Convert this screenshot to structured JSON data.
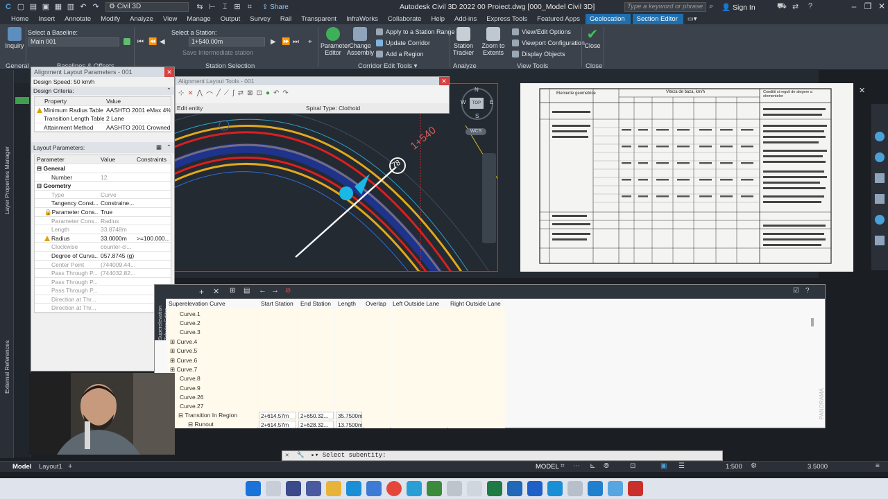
{
  "titlebar": {
    "workspace": "Civil 3D",
    "title": "Autodesk Civil 3D 2022    00 Proiect.dwg [000_Model Civil 3D]",
    "share": "Share",
    "search_placeholder": "Type a keyword or phrase",
    "signin": "Sign In"
  },
  "ribbon_tabs": [
    "Home",
    "Insert",
    "Annotate",
    "Modify",
    "Analyze",
    "View",
    "Manage",
    "Output",
    "Survey",
    "Rail",
    "Transparent",
    "InfraWorks",
    "Collaborate",
    "Help",
    "Add-ins",
    "Express Tools",
    "Featured Apps",
    "Geolocation",
    "Section Editor"
  ],
  "ribbon": {
    "inquiry": "Inquiry",
    "general": "General",
    "baseline_label": "Select a Baseline:",
    "baseline_value": "Main 001",
    "baselines_panel": "Baselines & Offsets",
    "station_label": "Select a Station:",
    "station_value": "1+540.00m",
    "save_intermediate": "Save Intermediate station",
    "station_panel": "Station Selection",
    "parameter_editor": "Parameter Editor",
    "change_assembly": "Change Assembly",
    "apply_range": "Apply to a Station Range",
    "update_corridor": "Update Corridor",
    "add_region": "Add a Region",
    "corridor_panel": "Corridor Edit Tools",
    "station_tracker": "Station Tracker",
    "zoom_extents": "Zoom to Extents",
    "analyze_panel": "Analyze",
    "view_edit_options": "View/Edit Options",
    "viewport_config": "Viewport Configuration",
    "display_objects": "Display Objects",
    "view_tools_panel": "View Tools",
    "close": "Close",
    "close_panel": "Close"
  },
  "alignment_params": {
    "title": "Alignment Layout Parameters - 001",
    "design_speed": "Design Speed: 50 km/h",
    "design_criteria": "Design Criteria:",
    "crit_headers": [
      "Property",
      "Value"
    ],
    "criteria": [
      {
        "prop": "Minimum Radius Table",
        "value": "AASHTO 2001 eMax 4% ..."
      },
      {
        "prop": "Transition Length Table",
        "value": "2 Lane"
      },
      {
        "prop": "Attainment Method",
        "value": "AASHTO 2001 Crowned ..."
      }
    ],
    "layout_params": "Layout Parameters:",
    "lp_headers": [
      "Parameter",
      "Value",
      "Constraints"
    ],
    "groups": [
      "General",
      "Geometry"
    ],
    "rows": [
      {
        "p": "Number",
        "v": "12",
        "c": ""
      },
      {
        "p": "Type",
        "v": "Curve",
        "c": ""
      },
      {
        "p": "Tangency Const...",
        "v": "Constraine...",
        "c": ""
      },
      {
        "p": "Parameter Cons...",
        "v": "True",
        "c": ""
      },
      {
        "p": "Parameter Cons...",
        "v": "Radius",
        "c": ""
      },
      {
        "p": "Length",
        "v": "33.8748m",
        "c": ""
      },
      {
        "p": "Radius",
        "v": "33.0000m",
        "c": ">=100.000..."
      },
      {
        "p": "Clockwise",
        "v": "counter-cl...",
        "c": ""
      },
      {
        "p": "Degree of Curva...",
        "v": "057.8745 (g)",
        "c": ""
      },
      {
        "p": "Center Point",
        "v": "(744009.44...",
        "c": ""
      },
      {
        "p": "Pass Through P...",
        "v": "(744032.82...",
        "c": ""
      },
      {
        "p": "Pass Through P...",
        "v": "",
        "c": ""
      },
      {
        "p": "Pass Through P...",
        "v": "",
        "c": ""
      },
      {
        "p": "Direction at Thr...",
        "v": "",
        "c": ""
      },
      {
        "p": "Direction at Thr...",
        "v": "",
        "c": ""
      }
    ]
  },
  "layout_tools": {
    "title": "Alignment Layout Tools - 001",
    "edit_entity": "Edit entity",
    "spiral_type": "Spiral Type: Clothoid"
  },
  "viewport": {
    "station_label": "1+540",
    "marker": "78",
    "compass_top": "TOP",
    "compass_n": "N",
    "compass_e": "E",
    "compass_s": "S",
    "compass_w": "W",
    "wcs": "WCS"
  },
  "superelevation": {
    "side_tab": "Superelevation Tabular Editor",
    "headers": [
      "Superelevation Curve",
      "Start Station",
      "End Station",
      "Length",
      "Overlap",
      "Left Outside Lane",
      "Right Outside Lane"
    ],
    "curves": [
      "Curve.1",
      "Curve.2",
      "Curve.3",
      "Curve.4",
      "Curve.5",
      "Curve.6",
      "Curve.7",
      "Curve.8",
      "Curve.9",
      "Curve.26",
      "Curve.27"
    ],
    "transition": {
      "name": "Transition In Region",
      "start": "2+614.57m",
      "end": "2+650.32...",
      "length": "35.7500m"
    },
    "runout": {
      "name": "Runout",
      "start": "2+614.57m",
      "end": "2+628.32...",
      "length": "13.7500m"
    }
  },
  "side_tabs": {
    "layer_props": "Layer Properties Manager",
    "external_refs": "External References",
    "panorama": "PANORAMA"
  },
  "command": {
    "prompt": "Select subentity:"
  },
  "layout_tabs": [
    "Model",
    "Layout1"
  ],
  "status": {
    "model": "MODEL",
    "scale": "1:500",
    "value": "3.5000"
  },
  "document_image": {
    "heading": "Elemente geometrice",
    "speed_header": "Viteza de baza, km/h",
    "notes_header": "Conditii si reguli de alegere a elementelor"
  }
}
